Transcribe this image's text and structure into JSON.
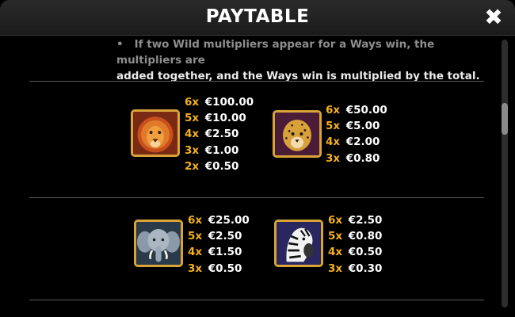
{
  "header": {
    "title": "PAYTABLE",
    "close_glyph": "✖",
    "close_icon": "close-icon"
  },
  "rules": {
    "line1": "If two Wild multipliers appear for a Ways win, the multipliers are",
    "line2": "added together, and the Ways win is multiplied by the total.",
    "bullet": "•"
  },
  "colors": {
    "multiplier": "#f4b11c",
    "amount": "#ffffff",
    "frame_gold": "#d9a437",
    "background": "#000000"
  },
  "symbols": [
    {
      "icon": "lion-icon",
      "pays": [
        {
          "mult": "6x",
          "amount": "€100.00"
        },
        {
          "mult": "5x",
          "amount": "€10.00"
        },
        {
          "mult": "4x",
          "amount": "€2.50"
        },
        {
          "mult": "3x",
          "amount": "€1.00"
        },
        {
          "mult": "2x",
          "amount": "€0.50"
        }
      ]
    },
    {
      "icon": "cheetah-icon",
      "pays": [
        {
          "mult": "6x",
          "amount": "€50.00"
        },
        {
          "mult": "5x",
          "amount": "€5.00"
        },
        {
          "mult": "4x",
          "amount": "€2.00"
        },
        {
          "mult": "3x",
          "amount": "€0.80"
        }
      ]
    },
    {
      "icon": "elephant-icon",
      "pays": [
        {
          "mult": "6x",
          "amount": "€25.00"
        },
        {
          "mult": "5x",
          "amount": "€2.50"
        },
        {
          "mult": "4x",
          "amount": "€1.50"
        },
        {
          "mult": "3x",
          "amount": "€0.50"
        }
      ]
    },
    {
      "icon": "zebra-icon",
      "pays": [
        {
          "mult": "6x",
          "amount": "€2.50"
        },
        {
          "mult": "5x",
          "amount": "€0.80"
        },
        {
          "mult": "4x",
          "amount": "€0.50"
        },
        {
          "mult": "3x",
          "amount": "€0.30"
        }
      ]
    }
  ]
}
